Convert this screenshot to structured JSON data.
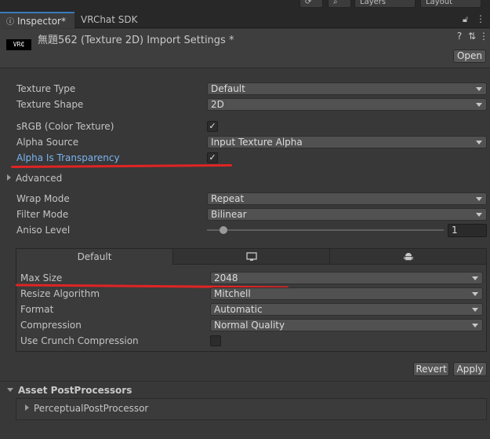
{
  "toolbar": {
    "layers_label": "Layers",
    "layout_label": "Layout"
  },
  "tabs": [
    {
      "label": "Inspector*",
      "active": true
    },
    {
      "label": "VRChat SDK",
      "active": false
    }
  ],
  "header": {
    "thumbnail_text": "VR₵",
    "title": "無題562 (Texture 2D) Import Settings *",
    "open_label": "Open"
  },
  "fields": {
    "texture_type": {
      "label": "Texture Type",
      "value": "Default"
    },
    "texture_shape": {
      "label": "Texture Shape",
      "value": "2D"
    },
    "srgb": {
      "label": "sRGB (Color Texture)",
      "checked": true
    },
    "alpha_source": {
      "label": "Alpha Source",
      "value": "Input Texture Alpha"
    },
    "alpha_is_transparency": {
      "label": "Alpha Is Transparency",
      "checked": true
    },
    "advanced": {
      "label": "Advanced"
    },
    "wrap_mode": {
      "label": "Wrap Mode",
      "value": "Repeat"
    },
    "filter_mode": {
      "label": "Filter Mode",
      "value": "Bilinear"
    },
    "aniso_level": {
      "label": "Aniso Level",
      "value": "1",
      "fraction": 0.07
    }
  },
  "platform": {
    "tabs": [
      {
        "label": "Default",
        "icon": null
      },
      {
        "label": "",
        "icon": "monitor-icon"
      },
      {
        "label": "",
        "icon": "android-icon"
      }
    ],
    "max_size": {
      "label": "Max Size",
      "value": "2048"
    },
    "resize_algorithm": {
      "label": "Resize Algorithm",
      "value": "Mitchell"
    },
    "format": {
      "label": "Format",
      "value": "Automatic"
    },
    "compression": {
      "label": "Compression",
      "value": "Normal Quality"
    },
    "crunch": {
      "label": "Use Crunch Compression",
      "checked": false
    }
  },
  "actions": {
    "revert_label": "Revert",
    "apply_label": "Apply"
  },
  "postprocessors": {
    "title": "Asset PostProcessors",
    "items": [
      "PerceptualPostProcessor"
    ]
  },
  "colors": {
    "accent": "#3a79bb",
    "highlight_label": "#7ab4ef",
    "annotation": "#e02424"
  }
}
